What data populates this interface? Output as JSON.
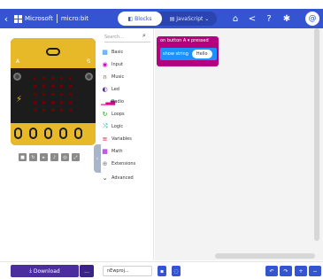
{
  "header": {
    "brand": "Microsoft",
    "product": "micro:bit",
    "modes": {
      "blocks": "Blocks",
      "javascript": "JavaScript"
    },
    "icons": [
      "home-icon",
      "share-icon",
      "help-icon",
      "gear-icon"
    ],
    "avatar_initial": "@"
  },
  "toolbox": {
    "search_placeholder": "Search...",
    "categories": [
      {
        "label": "Basic",
        "color": "#1e90ff",
        "icon": "grid"
      },
      {
        "label": "Input",
        "color": "#d400d4",
        "icon": "target"
      },
      {
        "label": "Music",
        "color": "#e63022",
        "icon": "headphones"
      },
      {
        "label": "Led",
        "color": "#5c2d91",
        "icon": "toggle"
      },
      {
        "label": "Radio",
        "color": "#e3008c",
        "icon": "bars"
      },
      {
        "label": "Loops",
        "color": "#00aa00",
        "icon": "refresh"
      },
      {
        "label": "Logic",
        "color": "#00a4a6",
        "icon": "shuffle"
      },
      {
        "label": "Variables",
        "color": "#dc143c",
        "icon": "list"
      },
      {
        "label": "Math",
        "color": "#9400d3",
        "icon": "calc"
      },
      {
        "label": "Extensions",
        "color": "#7f7f7f",
        "icon": "plus-circle"
      },
      {
        "label": "Advanced",
        "color": "#333333",
        "icon": "chevron-down"
      }
    ]
  },
  "workspace": {
    "event_block": "on button A ▾ pressed",
    "action_block": "show string",
    "action_value": "Hello"
  },
  "footer": {
    "download_label": "Download",
    "more_label": "...",
    "project_name": "nEwproj..."
  },
  "colors": {
    "header": "#3454d1",
    "download": "#4b2d9e",
    "event_block": "#b2007e",
    "basic_block": "#1e90ff",
    "board_gold": "#e7b928"
  }
}
